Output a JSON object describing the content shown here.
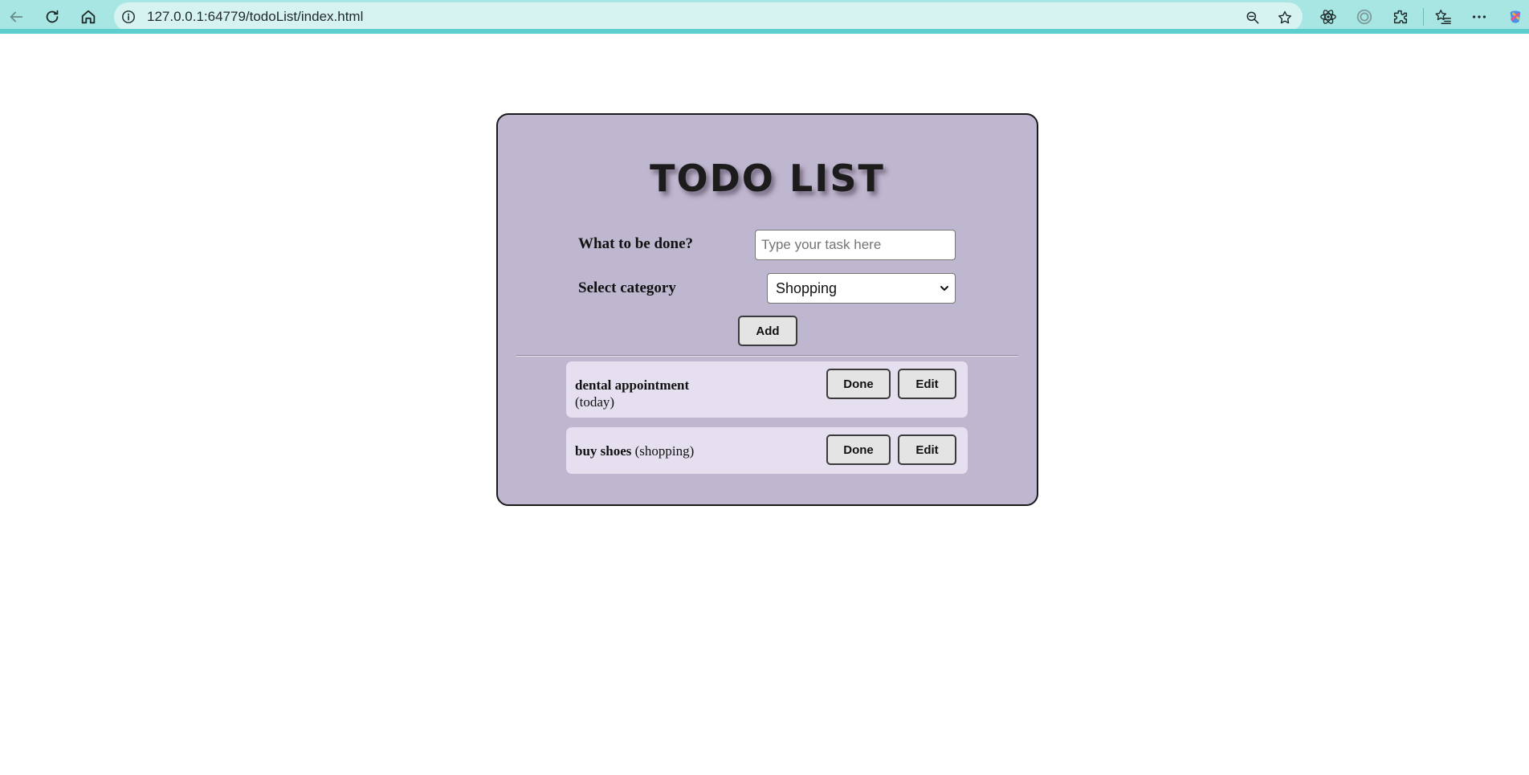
{
  "browser": {
    "url": "127.0.0.1:64779/todoList/index.html",
    "colors": {
      "toolbar": "#a8e6e3",
      "address_bar": "#d6f3f2",
      "accent_strip": "#5ccfcd"
    }
  },
  "app": {
    "title": "TODO LIST",
    "colors": {
      "card_bg": "#bfb6cf",
      "item_bg": "#e6dff0",
      "button_bg": "#e4e4e4"
    },
    "form": {
      "task_label": "What to be done?",
      "task_placeholder": "Type your task here",
      "task_value": "",
      "category_label": "Select category",
      "category_selected": "Shopping",
      "add_label": "Add"
    },
    "todos": [
      {
        "task": "dental appointment",
        "category": "(today)",
        "done_label": "Done",
        "edit_label": "Edit"
      },
      {
        "task": "buy shoes",
        "category": "(shopping)",
        "done_label": "Done",
        "edit_label": "Edit"
      }
    ]
  }
}
